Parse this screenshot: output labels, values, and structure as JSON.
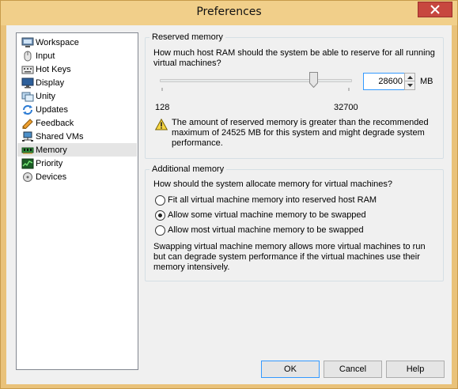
{
  "window": {
    "title": "Preferences"
  },
  "sidebar": {
    "items": [
      {
        "label": "Workspace",
        "icon": "workspace-icon"
      },
      {
        "label": "Input",
        "icon": "mouse-icon"
      },
      {
        "label": "Hot Keys",
        "icon": "keyboard-icon"
      },
      {
        "label": "Display",
        "icon": "monitor-icon"
      },
      {
        "label": "Unity",
        "icon": "unity-icon"
      },
      {
        "label": "Updates",
        "icon": "updates-icon"
      },
      {
        "label": "Feedback",
        "icon": "feedback-icon"
      },
      {
        "label": "Shared VMs",
        "icon": "shared-vms-icon"
      },
      {
        "label": "Memory",
        "icon": "memory-icon",
        "selected": true
      },
      {
        "label": "Priority",
        "icon": "priority-icon"
      },
      {
        "label": "Devices",
        "icon": "devices-icon"
      }
    ]
  },
  "reserved": {
    "title": "Reserved memory",
    "question": "How much host RAM should the system be able to reserve for all running virtual machines?",
    "slider_min_label": "128",
    "slider_max_label": "32700",
    "slider_min": 128,
    "slider_max": 32700,
    "value": "28600",
    "value_number": 28600,
    "unit": "MB",
    "warning_line1": "The amount of reserved memory is greater than the recommended",
    "warning_line2": "maximum of 24525 MB for this system and might degrade system",
    "warning_line3": "performance."
  },
  "additional": {
    "title": "Additional memory",
    "question": "How should the system allocate memory for virtual machines?",
    "options": [
      {
        "label": "Fit all virtual machine memory into reserved host RAM",
        "checked": false
      },
      {
        "label": "Allow some virtual machine memory to be swapped",
        "checked": true
      },
      {
        "label": "Allow most virtual machine memory to be swapped",
        "checked": false
      }
    ],
    "note_line1": "Swapping virtual machine memory allows more virtual machines to run",
    "note_line2": "but can degrade system performance if the virtual machines use their",
    "note_line3": "memory intensively."
  },
  "buttons": {
    "ok": "OK",
    "cancel": "Cancel",
    "help": "Help"
  },
  "colors": {
    "frame": "#e9c27a",
    "close": "#c7473f",
    "focus": "#3399ff",
    "warning": "#f5d442"
  }
}
